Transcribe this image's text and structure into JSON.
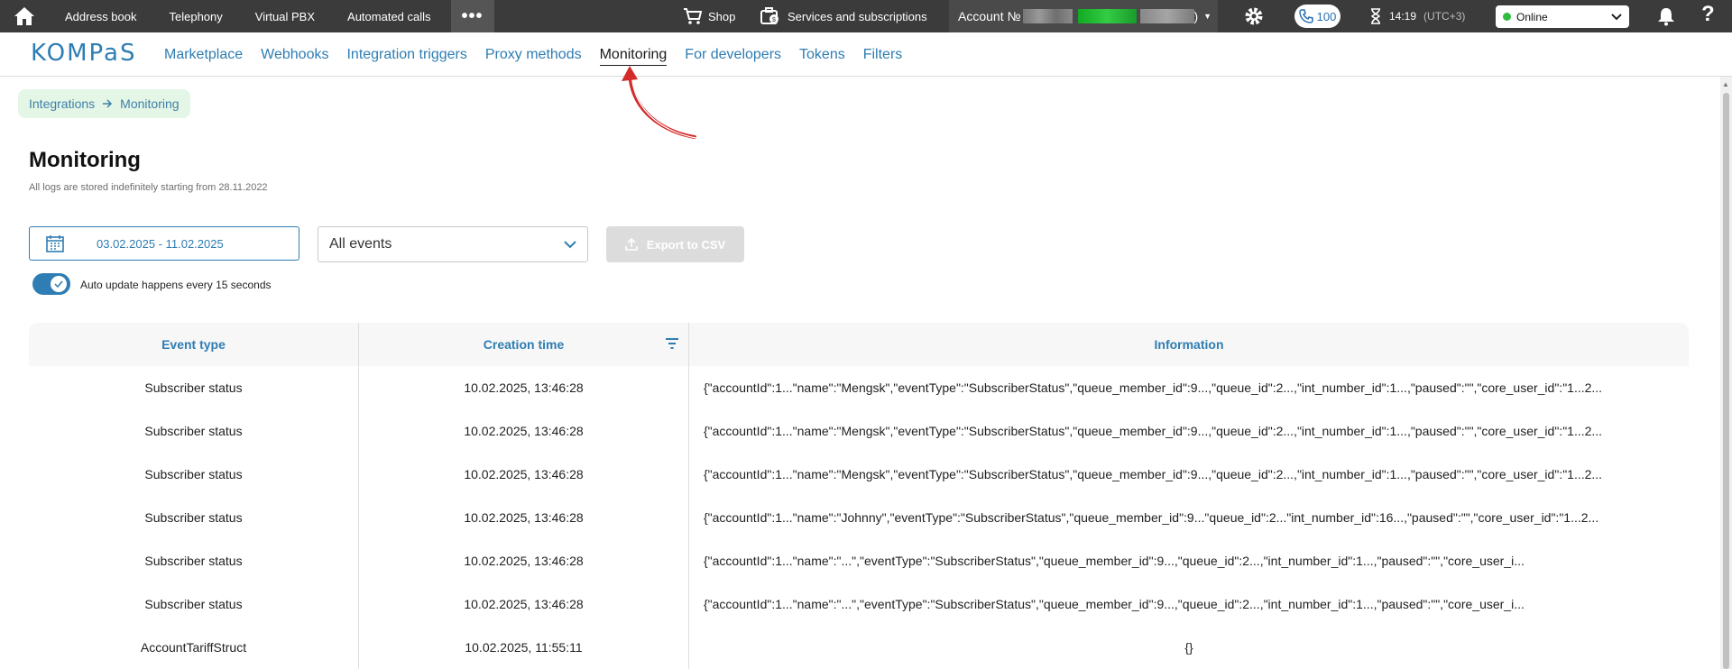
{
  "topbar": {
    "links": [
      "Address book",
      "Telephony",
      "Virtual PBX",
      "Automated calls"
    ],
    "more": "•••",
    "shop": "Shop",
    "services": "Services and subscriptions",
    "account_label": "Account №",
    "account_suffix": ")",
    "calls_count": "100",
    "time": "14:19",
    "timezone": "(UTC+3)",
    "status": "Online",
    "help": "?"
  },
  "nav": {
    "logo": "KOMPaS",
    "items": [
      "Marketplace",
      "Webhooks",
      "Integration triggers",
      "Proxy methods",
      "Monitoring",
      "For developers",
      "Tokens",
      "Filters"
    ],
    "active": "Monitoring"
  },
  "breadcrumb": {
    "parent": "Integrations",
    "current": "Monitoring"
  },
  "page": {
    "title": "Monitoring",
    "subtitle": "All logs are stored indefinitely starting from 28.11.2022"
  },
  "filters": {
    "date_range": "03.02.2025 - 11.02.2025",
    "events_select": "All events",
    "export_label": "Export to CSV",
    "auto_update_label": "Auto update happens every 15 seconds",
    "auto_update_on": true
  },
  "table": {
    "headers": [
      "Event type",
      "Creation time",
      "Information"
    ],
    "rows": [
      {
        "event": "Subscriber status",
        "time": "10.02.2025, 13:46:28",
        "info": "{\"accountId\":1...\"name\":\"Mengsk\",\"eventType\":\"SubscriberStatus\",\"queue_member_id\":9...,\"queue_id\":2...,\"int_number_id\":1...,\"paused\":\"\",\"core_user_id\":\"1...2..."
      },
      {
        "event": "Subscriber status",
        "time": "10.02.2025, 13:46:28",
        "info": "{\"accountId\":1...\"name\":\"Mengsk\",\"eventType\":\"SubscriberStatus\",\"queue_member_id\":9...,\"queue_id\":2...,\"int_number_id\":1...,\"paused\":\"\",\"core_user_id\":\"1...2..."
      },
      {
        "event": "Subscriber status",
        "time": "10.02.2025, 13:46:28",
        "info": "{\"accountId\":1...\"name\":\"Mengsk\",\"eventType\":\"SubscriberStatus\",\"queue_member_id\":9...,\"queue_id\":2...,\"int_number_id\":1...,\"paused\":\"\",\"core_user_id\":\"1...2..."
      },
      {
        "event": "Subscriber status",
        "time": "10.02.2025, 13:46:28",
        "info": "{\"accountId\":1...\"name\":\"Johnny\",\"eventType\":\"SubscriberStatus\",\"queue_member_id\":9...\"queue_id\":2...\"int_number_id\":16...,\"paused\":\"\",\"core_user_id\":\"1...2..."
      },
      {
        "event": "Subscriber status",
        "time": "10.02.2025, 13:46:28",
        "info": "{\"accountId\":1...\"name\":\"...\",\"eventType\":\"SubscriberStatus\",\"queue_member_id\":9...,\"queue_id\":2...,\"int_number_id\":1...,\"paused\":\"\",\"core_user_i..."
      },
      {
        "event": "Subscriber status",
        "time": "10.02.2025, 13:46:28",
        "info": "{\"accountId\":1...\"name\":\"...\",\"eventType\":\"SubscriberStatus\",\"queue_member_id\":9...,\"queue_id\":2...,\"int_number_id\":1...,\"paused\":\"\",\"core_user_i..."
      },
      {
        "event": "AccountTariffStruct",
        "time": "10.02.2025, 11:55:11",
        "info": "{}"
      }
    ]
  },
  "colors": {
    "accent": "#2e7db3",
    "topbar": "#3b3b3b",
    "breadcrumb_bg": "#e4f7e7",
    "online": "#2fbd3f",
    "annotation": "#d42a2a"
  }
}
